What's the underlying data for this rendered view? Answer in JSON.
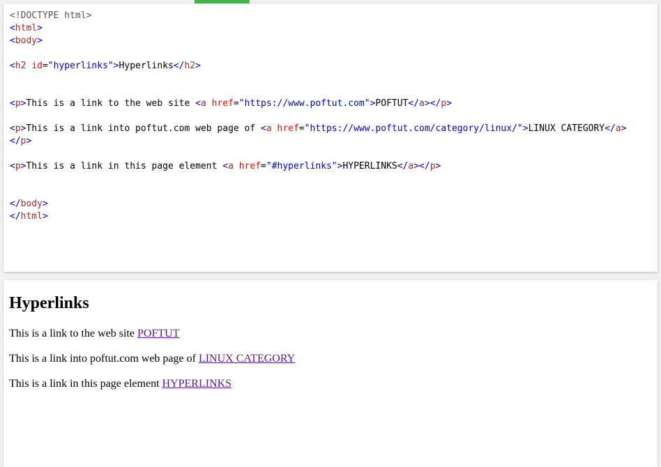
{
  "code": {
    "doctype": "<!DOCTYPE html>",
    "html_tag": "html",
    "body_tag": "body",
    "h2_tag": "h2",
    "id_attr": "id",
    "id_value": "\"hyperlinks\"",
    "h2_text": "Hyperlinks",
    "p_tag": "p",
    "a_tag": "a",
    "href_attr": "href",
    "lines": [
      {
        "prefix": "This is a link to the web site ",
        "href": "\"https://www.poftut.com\"",
        "link": "POFTUT"
      },
      {
        "prefix": "This is a link into poftut.com web page of ",
        "href": "\"https://www.poftut.com/category/linux/\"",
        "link": "LINUX CATEGORY"
      },
      {
        "prefix": "This is a link in this page element ",
        "href": "\"#hyperlinks\"",
        "link": "HYPERLINKS"
      }
    ]
  },
  "result": {
    "heading": "Hyperlinks",
    "paragraphs": [
      {
        "text": "This is a link to the web site ",
        "link": "POFTUT"
      },
      {
        "text": "This is a link into poftut.com web page of ",
        "link": "LINUX CATEGORY"
      },
      {
        "text": "This is a link in this page element ",
        "link": "HYPERLINKS"
      }
    ]
  },
  "colors": {
    "accent": "#4caf50",
    "tag": "#a52a2a",
    "bracket": "#0000cd",
    "attribute": "#ff0000",
    "value": "#0000cd",
    "visited_link": "#551a8b"
  }
}
